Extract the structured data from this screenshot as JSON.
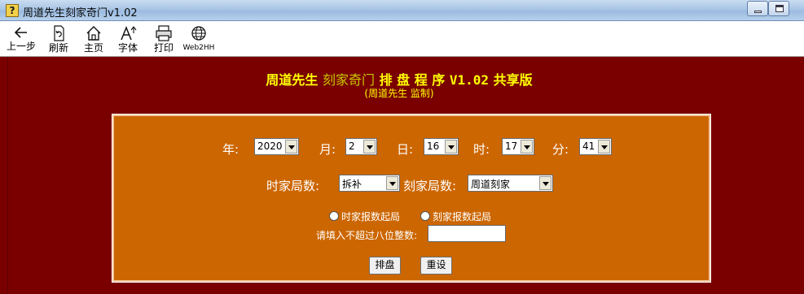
{
  "window": {
    "title": "周道先生刻家奇门v1.02",
    "app_icon": "?"
  },
  "toolbar": {
    "items": [
      {
        "label": "上一步",
        "icon": "back-arrow-icon"
      },
      {
        "label": "刷新",
        "icon": "refresh-icon"
      },
      {
        "label": "主页",
        "icon": "home-icon"
      },
      {
        "label": "字体",
        "icon": "font-icon"
      },
      {
        "label": "打印",
        "icon": "printer-icon"
      },
      {
        "label": "Web2HH",
        "icon": "globe-icon"
      }
    ]
  },
  "header": {
    "title_a": "周道先生",
    "title_b": "刻家奇门",
    "title_c": "排 盘 程 序",
    "title_d": "V1.02",
    "title_e": "共享版",
    "subtitle": "(周道先生 监制)"
  },
  "form": {
    "date_row": {
      "year_label": "年:",
      "year_value": "2020",
      "month_label": "月:",
      "month_value": "2",
      "day_label": "日:",
      "day_value": "16",
      "hour_label": "时:",
      "hour_value": "17",
      "minute_label": "分:",
      "minute_value": "41"
    },
    "ju_row": {
      "shijia_label": "时家局数:",
      "shijia_value": "拆补",
      "kejia_label": "刻家局数:",
      "kejia_value": "周道刻家"
    },
    "radios": {
      "shijia": "时家报数起局",
      "kejia": "刻家报数起局"
    },
    "number_prompt": "请填入不超过八位整数:",
    "number_value": "",
    "buttons": {
      "paipan": "排盘",
      "reset": "重设"
    }
  },
  "colors": {
    "background": "#7a0000",
    "panel": "#cc6600",
    "heading": "#ffff00",
    "titlebar": "#a9c6e6"
  }
}
